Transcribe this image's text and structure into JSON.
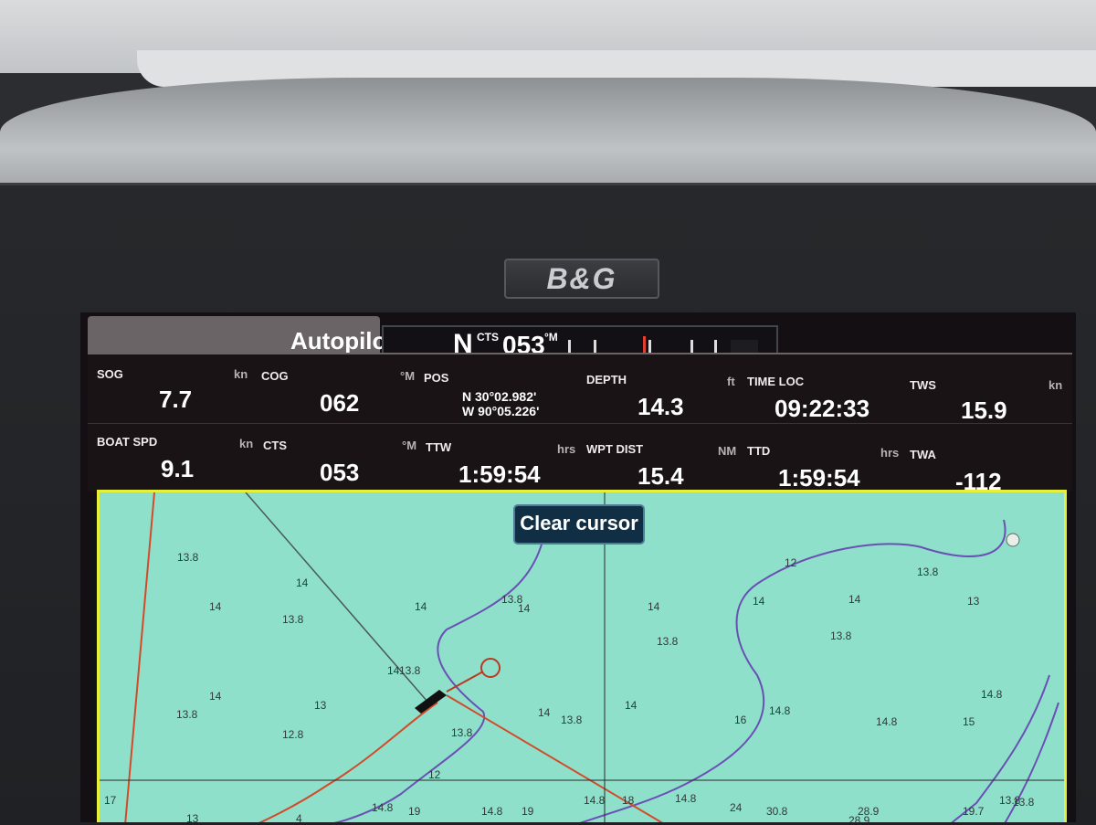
{
  "brand": "B&G",
  "title_bar": {
    "page_name": "Autopilot",
    "compass": {
      "north": "N",
      "cts_label": "CTS",
      "cts_value": "053",
      "cts_unit": "°M"
    }
  },
  "data_panel": {
    "sog": {
      "label": "SOG",
      "value": "7.7",
      "unit": "kn"
    },
    "cog": {
      "label": "COG",
      "value": "062",
      "unit": "°M"
    },
    "pos": {
      "label": "POS",
      "lat": "N 30°02.982'",
      "lon": "W 90°05.226'"
    },
    "depth": {
      "label": "DEPTH",
      "value": "14.3",
      "unit": "ft"
    },
    "time_loc": {
      "label": "TIME LOC",
      "value": "09:22:33"
    },
    "tws": {
      "label": "TWS",
      "value": "15.9",
      "unit": "kn"
    },
    "boat_spd": {
      "label": "BOAT SPD",
      "value": "9.1",
      "unit": "kn"
    },
    "cts": {
      "label": "CTS",
      "value": "053",
      "unit": "°M"
    },
    "ttw": {
      "label": "TTW",
      "value": "1:59:54",
      "unit": "hrs"
    },
    "wpt_dist": {
      "label": "WPT DIST",
      "value": "15.4",
      "unit": "NM"
    },
    "ttd": {
      "label": "TTD",
      "value": "1:59:54",
      "unit": "hrs"
    },
    "twa": {
      "label": "TWA",
      "value": "-112"
    }
  },
  "chart": {
    "clear_cursor_label": "Clear cursor",
    "soundings": [
      "13.8",
      "14",
      "14",
      "13.8",
      "14",
      "13.8",
      "14",
      "14",
      "13.8",
      "12",
      "13.8",
      "14",
      "14",
      "13.8",
      "13",
      "14.8",
      "13.8",
      "12.8",
      "14",
      "13",
      "13.8",
      "14",
      "14",
      "13.8",
      "14",
      "16",
      "14.8",
      "14.8",
      "15",
      "13.8",
      "12",
      "14.8",
      "19",
      "14.8",
      "19",
      "14.8",
      "18",
      "14.8",
      "24",
      "30.8",
      "28.9",
      "24",
      "19.7",
      "13.8",
      "17",
      "13",
      "4",
      "28.9",
      "13.8"
    ],
    "colors": {
      "water": "#8fe0cb",
      "border": "#e6ef3a",
      "contour": "#6a4fb4",
      "route": "#d24a2a"
    }
  }
}
